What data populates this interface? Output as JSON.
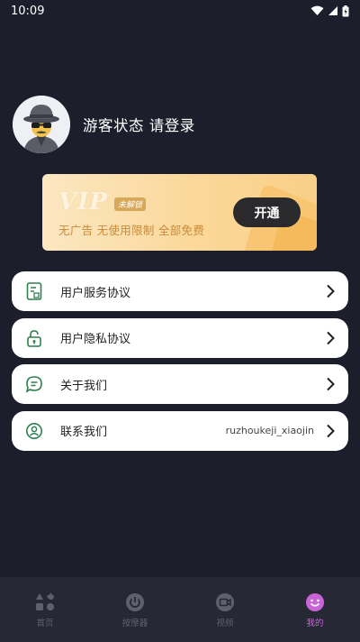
{
  "status_bar": {
    "time": "10:09",
    "icons": [
      "wifi-icon",
      "signal-icon",
      "battery-icon"
    ]
  },
  "profile": {
    "avatar_icon": "incognito-avatar-icon",
    "login_text": "游客状态 请登录"
  },
  "vip": {
    "logo": "VIP",
    "status": "未解锁",
    "description": "无广告 无使用限制 全部免费",
    "open_button": "开通"
  },
  "menu": {
    "items": [
      {
        "icon": "document-icon",
        "label": "用户服务协议",
        "value": ""
      },
      {
        "icon": "lock-icon",
        "label": "用户隐私协议",
        "value": ""
      },
      {
        "icon": "chat-icon",
        "label": "关于我们",
        "value": ""
      },
      {
        "icon": "contact-icon",
        "label": "联系我们",
        "value": "ruzhoukeji_xiaojin"
      }
    ]
  },
  "tabbar": {
    "tabs": [
      {
        "icon": "home-grid-icon",
        "label": "首页",
        "active": false
      },
      {
        "icon": "power-icon",
        "label": "按摩器",
        "active": false
      },
      {
        "icon": "video-icon",
        "label": "视频",
        "active": false
      },
      {
        "icon": "smile-icon",
        "label": "我的",
        "active": true
      }
    ]
  },
  "colors": {
    "background": "#1c1e2b",
    "tabbar": "#262834",
    "active_tab": "#c964d8",
    "vip_text": "#c98a38"
  }
}
